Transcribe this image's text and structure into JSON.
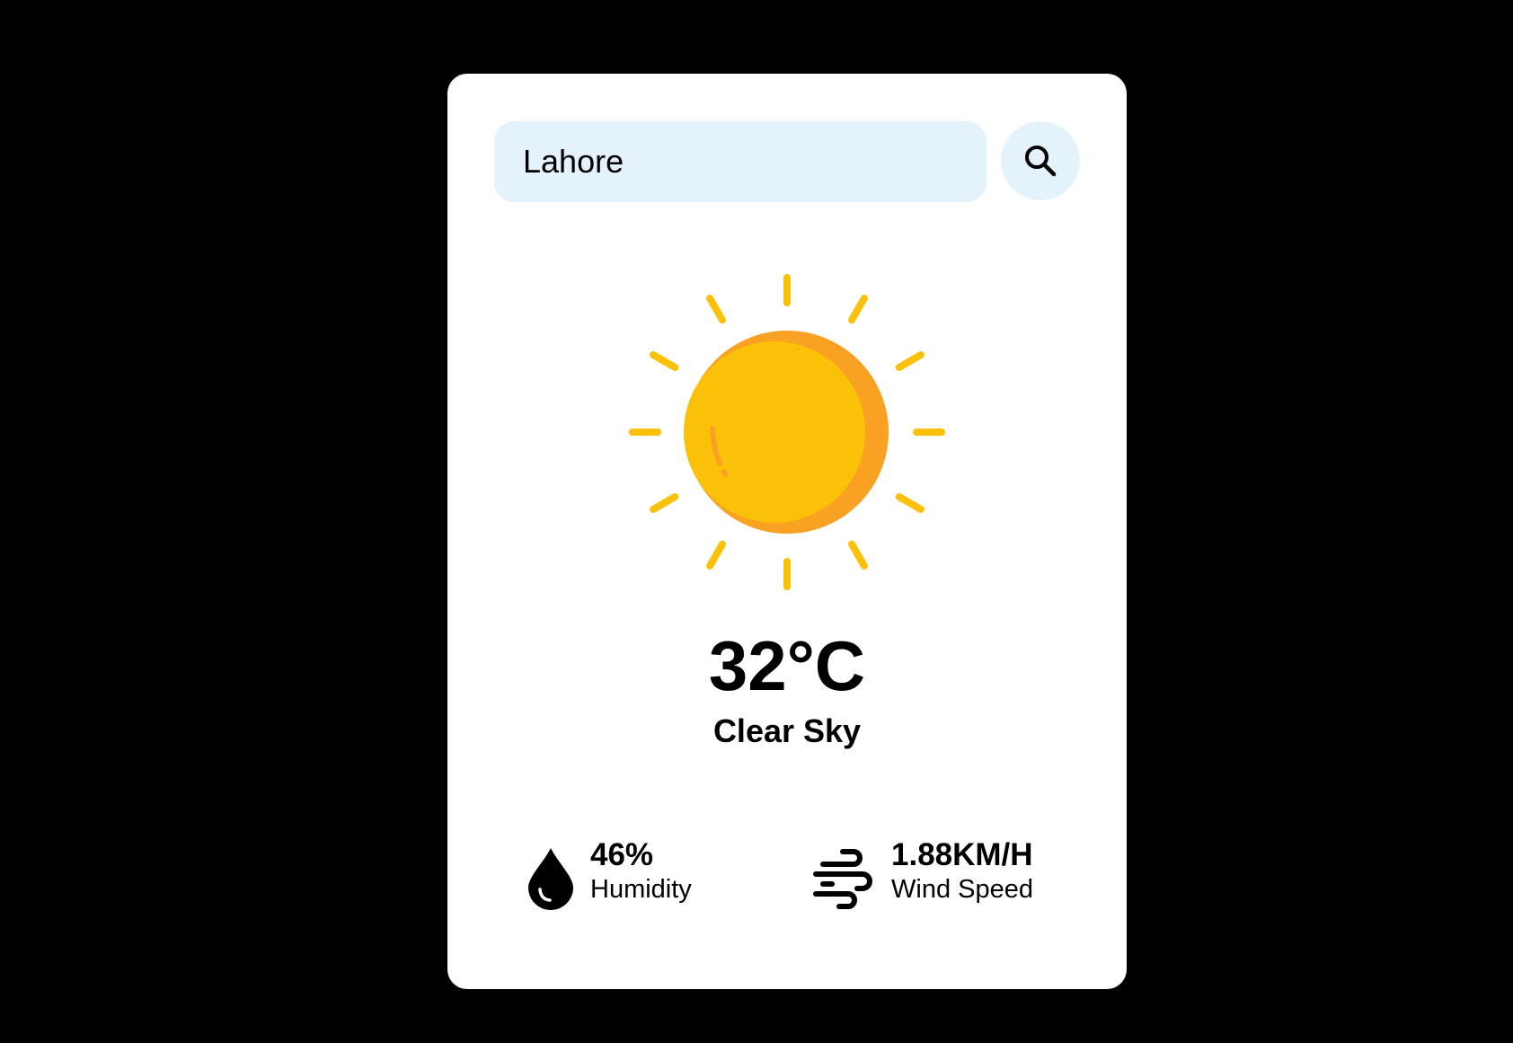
{
  "search": {
    "value": "Lahore",
    "placeholder": ""
  },
  "weather": {
    "temperature": "32°C",
    "condition": "Clear Sky",
    "icon": "sun-icon"
  },
  "stats": {
    "humidity": {
      "value": "46%",
      "label": "Humidity",
      "icon": "water-drop-icon"
    },
    "wind": {
      "value": "1.88KM/H",
      "label": "Wind Speed",
      "icon": "wind-icon"
    }
  },
  "colors": {
    "background": "#000000",
    "card": "#ffffff",
    "input_background": "#e4f3fb",
    "sun": "#fbc108",
    "sun_shade": "#f8a122",
    "text": "#000000"
  }
}
